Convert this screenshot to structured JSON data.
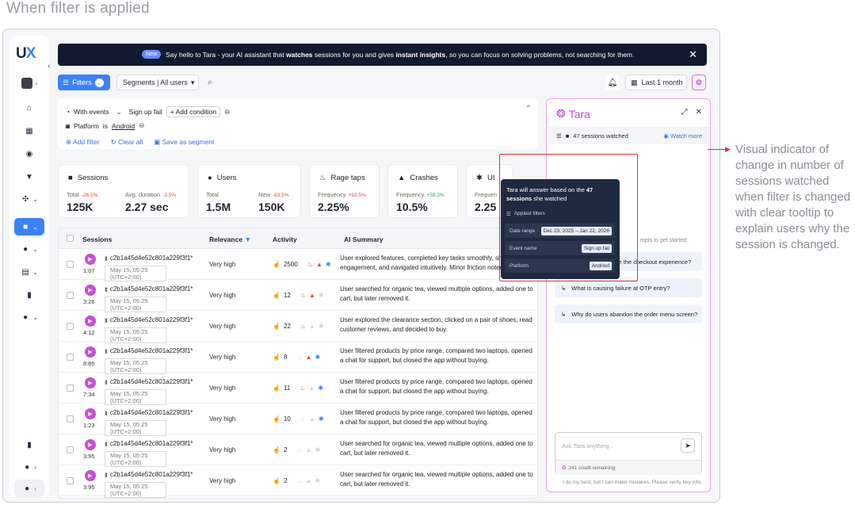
{
  "heading": "When filter is applied",
  "logo": {
    "a": "U",
    "b": "X"
  },
  "banner": {
    "new": "New",
    "pre": "Say hello to Tara - your AI assistant that ",
    "b1": "watches",
    "mid": " sessions for you and gives ",
    "b2": "instant insights",
    "post": ", so you can focus on solving problems, not searching for them."
  },
  "toolbar": {
    "filters": "Filters",
    "segments": "Segments | All users",
    "date": "Last 1 month"
  },
  "filters": {
    "with_events": "With events",
    "event": "Sign up fail",
    "add_condition": "+ Add condition",
    "platform": "Platform",
    "is": "is",
    "platform_value": "Android",
    "add_filter": "Add filter",
    "clear_all": "Clear all",
    "save_segment": "Save as segment"
  },
  "stats": [
    {
      "title": "Sessions",
      "a_label": "Total",
      "a_delta": "-26.5%",
      "a_val": "125K",
      "b_label": "Avg. duration",
      "b_delta": "-3.5%",
      "b_val": "2.27 sec"
    },
    {
      "title": "Users",
      "a_label": "Total",
      "a_delta": "",
      "a_val": "1.5M",
      "b_label": "New",
      "b_delta": "-93.5%",
      "b_val": "150K"
    },
    {
      "title": "Rage taps",
      "a_label": "Frequency",
      "a_delta": "+93.5%",
      "a_val": "2.25%"
    },
    {
      "title": "Crashes",
      "a_label": "Frequency",
      "a_delta": "+59.3%",
      "a_val": "10.5%"
    },
    {
      "title": "UI",
      "a_label": "Frequen",
      "a_val": "2.25"
    }
  ],
  "table": {
    "headers": {
      "sessions": "Sessions",
      "relevance": "Relevance",
      "activity": "Activity",
      "summary": "AI Summary"
    },
    "rows": [
      {
        "dur": "1:07",
        "id": "c2b1a45d4e52c801a229f3f1*",
        "date": "May 15, 05:25 (UTC+2:00)",
        "rel": "Very high",
        "count": "2500",
        "summary": "User explored features, completed key tasks smoothly, showed high engagement, and navigated intuitively. Minor friction noted in setti..."
      },
      {
        "dur": "3:26",
        "id": "c2b1a45d4e52c801a229f3f1*",
        "date": "May 15, 05:25 (UTC+2:00)",
        "rel": "Very high",
        "count": "12",
        "summary": "User searched for organic tea, viewed multiple options, added one to cart, but later removed it."
      },
      {
        "dur": "4:12",
        "id": "c2b1a45d4e52c801a229f3f1*",
        "date": "May 15, 05:25 (UTC+2:00)",
        "rel": "Very high",
        "count": "22",
        "summary": "User explored the clearance section, clicked on a pair of shoes, read customer reviews, and decided to buy."
      },
      {
        "dur": "8:85",
        "id": "c2b1a45d4e52c801a229f3f1*",
        "date": "May 15, 05:25 (UTC+2:00)",
        "rel": "Very high",
        "count": "8",
        "summary": "User filtered products by price range, compared two laptops, opened a chat for support, but closed the app without buying."
      },
      {
        "dur": "7:34",
        "id": "c2b1a45d4e52c801a229f3f1*",
        "date": "May 15, 05:25 (UTC+2:00)",
        "rel": "Very high",
        "count": "11",
        "summary": "User filtered products by price range, compared two laptops, opened a chat for support, but closed the app without buying."
      },
      {
        "dur": "1:23",
        "id": "c2b1a45d4e52c801a229f3f1*",
        "date": "May 15, 05:25 (UTC+2:00)",
        "rel": "Very high",
        "count": "10",
        "summary": "User filtered products by price range, compared two laptops, opened a chat for support, but closed the app without buying."
      },
      {
        "dur": "3:95",
        "id": "c2b1a45d4e52c801a229f3f1*",
        "date": "May 15, 05:25 (UTC+2:00)",
        "rel": "Very high",
        "count": "2",
        "summary": "User searched for organic tea, viewed multiple options, added one to cart, but later removed it."
      },
      {
        "dur": "3:95",
        "id": "c2b1a45d4e52c801a229f3f1*",
        "date": "May 15, 05:25 (UTC+2:00)",
        "rel": "Very high",
        "count": "2",
        "summary": "User searched for organic tea, viewed multiple options, added one to cart, but later removed it."
      }
    ]
  },
  "tara": {
    "brand": "Tara",
    "watched": "47 sessions watched",
    "watch_more": "Watch more",
    "hint": "mpts to get started:",
    "suggestions": [
      "How can I optimize the checkout experience?",
      "What is causing failure at OTP entry?",
      "Why do users abandon the order menu screen?"
    ],
    "placeholder": "Ask Tara anything...",
    "credit": "241 credit remaining",
    "disclaimer": "I do my best, but I can make mistakes. Please verify key info."
  },
  "tooltip": {
    "pre": "Tara will answer based on the ",
    "count": "47",
    "mid": "sessions",
    "post": " she watched",
    "applied": "Applied filters",
    "rows": [
      {
        "label": "Date range",
        "value": "Dec 23, 2025 – Jan 22, 2026"
      },
      {
        "label": "Event name",
        "value": "Sign up fail"
      },
      {
        "label": "Platform",
        "value": "Andriod"
      }
    ]
  },
  "note": "Visual indicator of change in number of sessions watched when filter is changed with clear tooltip to explain users why the session is changed."
}
